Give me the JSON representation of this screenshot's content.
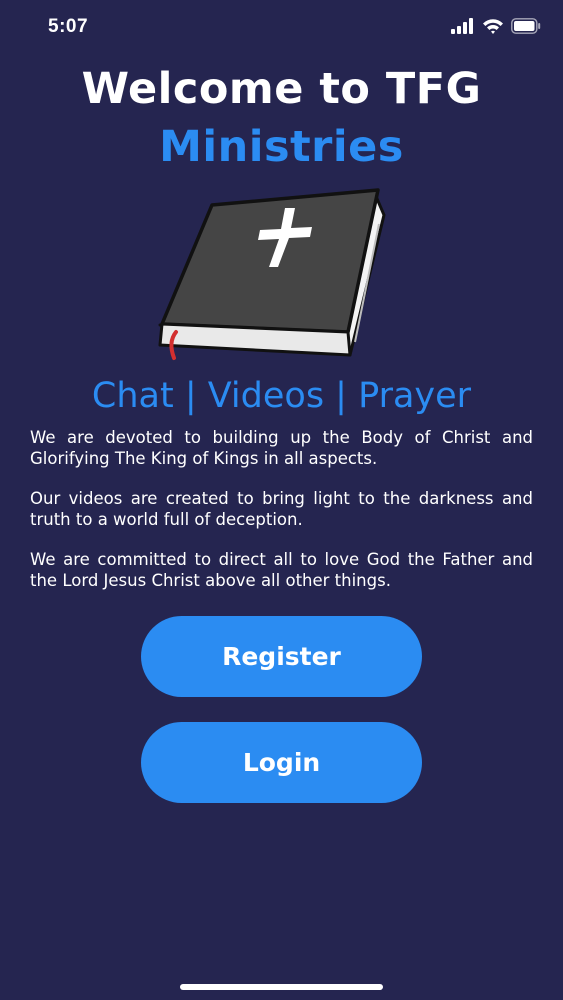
{
  "status_bar": {
    "time": "5:07",
    "icons": [
      "cellular-signal-icon",
      "wifi-icon",
      "battery-icon"
    ]
  },
  "header": {
    "title_line1": "Welcome to TFG",
    "title_line2": "Ministries"
  },
  "hero": {
    "icon": "bible-icon"
  },
  "features": {
    "text": "Chat | Videos | Prayer"
  },
  "description": {
    "paragraphs": [
      "We are devoted to building up the Body of Christ and Glorifying The King of Kings in all aspects.",
      "Our videos are created to bring light to the darkness and truth to a world full of deception.",
      "We are committed to direct all to love God the Father and the Lord Jesus Christ above all other things."
    ]
  },
  "actions": {
    "register_label": "Register",
    "login_label": "Login"
  },
  "colors": {
    "background": "#252550",
    "accent": "#2b8cf2",
    "text": "#ffffff"
  }
}
